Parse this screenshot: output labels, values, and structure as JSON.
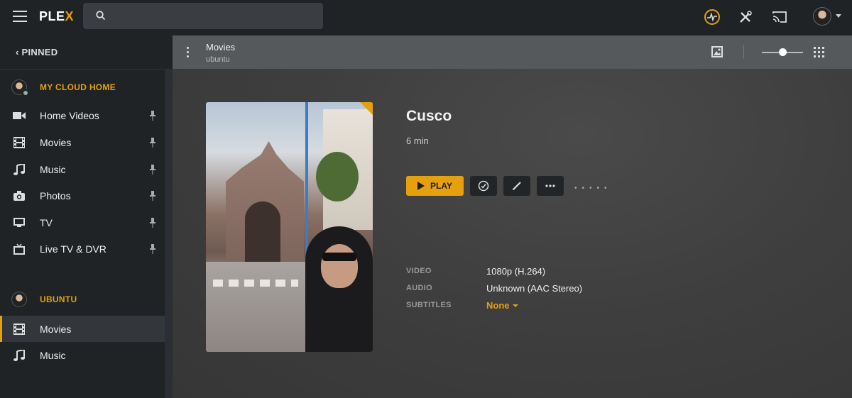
{
  "app": {
    "logo_prefix": "PLE",
    "logo_suffix": "X"
  },
  "search": {
    "placeholder": ""
  },
  "sidebar": {
    "pinned_label": "PINNED",
    "servers": [
      {
        "name": "MY CLOUD HOME",
        "items": [
          {
            "label": "Home Videos",
            "icon": "video-camera-icon"
          },
          {
            "label": "Movies",
            "icon": "film-icon"
          },
          {
            "label": "Music",
            "icon": "music-note-icon"
          },
          {
            "label": "Photos",
            "icon": "camera-icon"
          },
          {
            "label": "TV",
            "icon": "monitor-icon"
          },
          {
            "label": "Live TV & DVR",
            "icon": "tv-antenna-icon"
          }
        ]
      },
      {
        "name": "UBUNTU",
        "items": [
          {
            "label": "Movies",
            "icon": "film-icon",
            "active": true
          },
          {
            "label": "Music",
            "icon": "music-note-icon"
          }
        ]
      }
    ]
  },
  "header": {
    "title": "Movies",
    "subtitle": "ubuntu",
    "poster_size_level": 0.5
  },
  "item": {
    "title": "Cusco",
    "duration": "6 min",
    "play_label": "PLAY",
    "details": [
      {
        "label": "VIDEO",
        "value": "1080p (H.264)"
      },
      {
        "label": "AUDIO",
        "value": "Unknown (AAC Stereo)"
      },
      {
        "label": "SUBTITLES",
        "value": "None"
      }
    ]
  },
  "colors": {
    "accent": "#e5a00d",
    "topbar": "#1f2326",
    "header": "#55595c"
  }
}
